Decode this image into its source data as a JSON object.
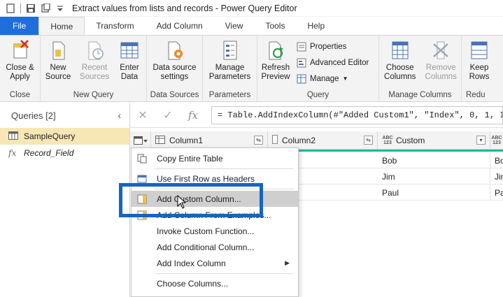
{
  "window": {
    "title": "Extract values from lists and records - Power Query Editor"
  },
  "tabs": [
    "File",
    "Home",
    "Transform",
    "Add Column",
    "View",
    "Tools",
    "Help"
  ],
  "active_tab": "Home",
  "ribbon": {
    "close": {
      "button": "Close &\nApply",
      "label": "Close"
    },
    "new_query": {
      "new_source": "New\nSource",
      "recent_sources": "Recent\nSources",
      "enter_data": "Enter\nData",
      "label": "New Query"
    },
    "data_sources": {
      "button": "Data source\nsettings",
      "label": "Data Sources"
    },
    "parameters": {
      "button": "Manage\nParameters",
      "label": "Parameters"
    },
    "query": {
      "refresh": "Refresh\nPreview",
      "properties": "Properties",
      "advanced_editor": "Advanced Editor",
      "manage": "Manage",
      "label": "Query"
    },
    "manage_columns": {
      "choose": "Choose\nColumns",
      "remove": "Remove\nColumns",
      "label": "Manage Columns"
    },
    "reduce": {
      "keep": "Keep\nRows",
      "label": "Redu"
    }
  },
  "queries": {
    "header": "Queries [2]",
    "items": [
      {
        "name": "SampleQuery",
        "selected": true
      },
      {
        "name": "Record_Field",
        "selected": false
      }
    ]
  },
  "formula": {
    "fx": "fx",
    "text": "= Table.AddIndexColumn(#\"Added Custom1\", \"Index\", 0, 1, Int64"
  },
  "grid": {
    "columns": [
      {
        "name": "Column1",
        "type": ""
      },
      {
        "name": "Column2",
        "type": ""
      },
      {
        "name": "Custom",
        "type": "ABC\n123"
      },
      {
        "name": "",
        "type": "ABC\n123"
      }
    ],
    "rows": [
      [
        "Bob",
        "Bo"
      ],
      [
        "Jim",
        "Jim"
      ],
      [
        "Paul",
        "Pa"
      ]
    ]
  },
  "context_menu": {
    "items": [
      {
        "label": "Copy Entire Table"
      },
      {
        "label": "Use First Row as Headers"
      },
      {
        "label": "Add Custom Column...",
        "highlighted": true
      },
      {
        "label": "Add Column From Examples..."
      },
      {
        "label": "Invoke Custom Function..."
      },
      {
        "label": "Add Conditional Column..."
      },
      {
        "label": "Add Index Column",
        "submenu": true
      },
      {
        "label": "Choose Columns..."
      }
    ]
  },
  "colors": {
    "accent": "#1e6fd9",
    "highlight_box": "#1565c0",
    "selected_query": "#f6e7b5",
    "quality": "#1fb89a"
  }
}
